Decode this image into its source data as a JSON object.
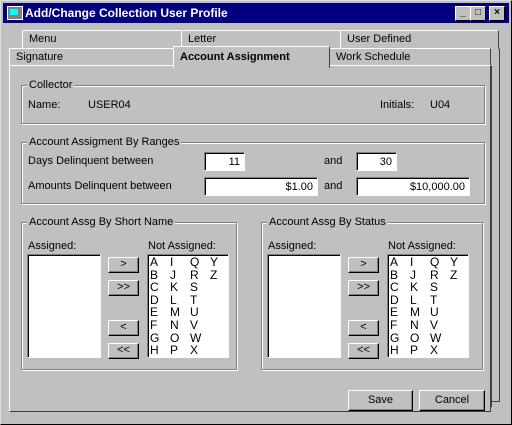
{
  "window": {
    "title": "Add/Change Collection User Profile",
    "controls": {
      "minimize": "_",
      "maximize": "□",
      "close": "×"
    }
  },
  "tabs": {
    "back_row": [
      "Menu",
      "Letter",
      "User Defined"
    ],
    "front_row": [
      "Signature",
      "Account Assignment",
      "Work Schedule"
    ],
    "active": "Account Assignment"
  },
  "collector": {
    "group_label": "Collector",
    "name_label": "Name:",
    "name_value": "USER04",
    "initials_label": "Initials:",
    "initials_value": "U04"
  },
  "ranges": {
    "group_label": "Account Assigment By Ranges",
    "days_label": "Days Delinquent between",
    "days_from": "11",
    "and1": "and",
    "days_to": "30",
    "amounts_label": "Amounts Delinquent between",
    "amount_from": "$1.00",
    "and2": "and",
    "amount_to": "$10,000.00"
  },
  "short_name": {
    "group_label": "Account Assg By Short Name",
    "assigned_label": "Assigned:",
    "not_assigned_label": "Not Assigned:",
    "not_assigned_columns": [
      [
        "A",
        "B",
        "C",
        "D",
        "E",
        "F",
        "G",
        "H"
      ],
      [
        "I",
        "J",
        "K",
        "L",
        "M",
        "N",
        "O",
        "P"
      ],
      [
        "Q",
        "R",
        "S",
        "T",
        "U",
        "V",
        "W",
        "X"
      ],
      [
        "Y",
        "Z"
      ]
    ]
  },
  "status": {
    "group_label": "Account Assg By Status",
    "assigned_label": "Assigned:",
    "not_assigned_label": "Not Assigned:",
    "not_assigned_columns": [
      [
        "A",
        "B",
        "C",
        "D",
        "E",
        "F",
        "G",
        "H"
      ],
      [
        "I",
        "J",
        "K",
        "L",
        "M",
        "N",
        "O",
        "P"
      ],
      [
        "Q",
        "R",
        "S",
        "T",
        "U",
        "V",
        "W",
        "X"
      ],
      [
        "Y",
        "Z"
      ]
    ]
  },
  "move_buttons": {
    "add": ">",
    "add_all": ">>",
    "remove": "<",
    "remove_all": "<<"
  },
  "actions": {
    "save": "Save",
    "cancel": "Cancel"
  }
}
